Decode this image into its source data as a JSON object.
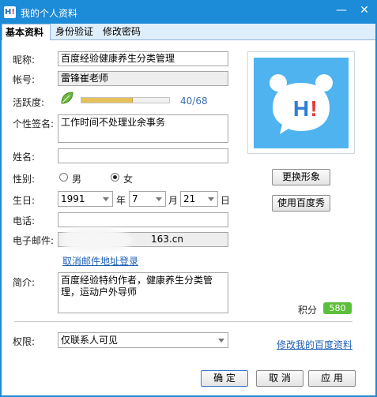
{
  "window": {
    "title": "我的个人资料",
    "icon_text": "H",
    "icon_bang": "!",
    "min_glyph": "—",
    "close_glyph": "✕"
  },
  "tabs": [
    {
      "label": "基本资料",
      "active": true
    },
    {
      "label": "身份验证",
      "active": false
    },
    {
      "label": "修改密码",
      "active": false
    }
  ],
  "form": {
    "nickname_label": "昵称:",
    "nickname_value": "百度经验健康养生分类管理",
    "account_label": "帐号:",
    "account_value": "雷锋崔老师",
    "activity_label": "活跃度:",
    "activity_text": "40/68",
    "activity_fraction": 0.588,
    "signature_label": "个性签名:",
    "signature_value": "工作时间不处理业余事务",
    "name_label": "姓名:",
    "name_value": "",
    "gender_label": "性别:",
    "gender_male": "男",
    "gender_female": "女",
    "gender_selected": "female",
    "birthday_label": "生日:",
    "birth_year": "1991",
    "year_unit": "年",
    "birth_month": "7",
    "month_unit": "月",
    "birth_day": "21",
    "day_unit": "日",
    "phone_label": "电话:",
    "phone_value": "",
    "email_label": "电子邮件:",
    "email_value": "163.cn",
    "cancel_email_login_link": "取消邮件地址登录",
    "intro_label": "简介:",
    "intro_value": "百度经验特约作者，健康养生分类管理，运动户外导师",
    "score_label": "积分",
    "score_value": "580",
    "permission_label": "权限:",
    "permission_value": "仅联系人可见",
    "edit_baidu_profile_link": "修改我的百度资料"
  },
  "avatar": {
    "change_button": "更换形象",
    "use_baidu_show_button": "使用百度秀",
    "bubble_text": "H",
    "bubble_bang": "!",
    "bg_color": "#4fb3ef"
  },
  "footer": {
    "ok_button": "确 定",
    "cancel_button": "取 消",
    "apply_button": "应 用"
  },
  "colors": {
    "titlebar": "#1c8bd8",
    "link": "#1d5fb3",
    "score_badge": "#5bbf3a"
  }
}
